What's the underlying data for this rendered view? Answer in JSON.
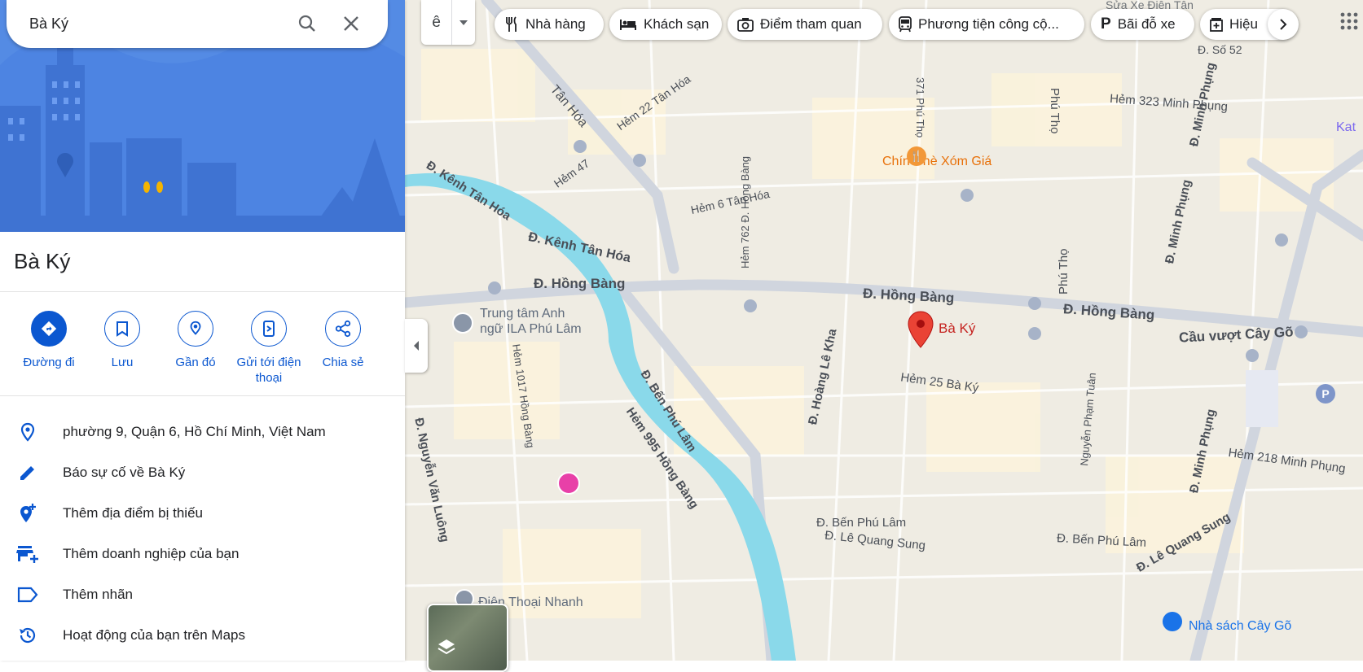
{
  "search": {
    "value": "Bà Ký"
  },
  "place": {
    "title": "Bà Ký"
  },
  "actions": [
    {
      "label": "Đường đi"
    },
    {
      "label": "Lưu"
    },
    {
      "label": "Gần đó"
    },
    {
      "label": "Gửi tới điện thoại"
    },
    {
      "label": "Chia sẻ"
    }
  ],
  "info_rows": [
    {
      "icon": "location-pin-icon",
      "text": "phường 9, Quận 6, Hồ Chí Minh, Việt Nam"
    },
    {
      "icon": "edit-pencil-icon",
      "text": "Báo sự cố về Bà Ký"
    },
    {
      "icon": "add-place-icon",
      "text": "Thêm địa điểm bị thiếu"
    },
    {
      "icon": "add-business-icon",
      "text": "Thêm doanh nghiệp của bạn"
    },
    {
      "icon": "label-icon",
      "text": "Thêm nhãn"
    },
    {
      "icon": "history-icon",
      "text": "Hoạt động của bạn trên Maps"
    }
  ],
  "language_button": {
    "label": "ê"
  },
  "chips": [
    {
      "icon": "restaurant-icon",
      "label": "Nhà hàng"
    },
    {
      "icon": "hotel-icon",
      "label": "Khách sạn"
    },
    {
      "icon": "camera-icon",
      "label": "Điểm tham quan"
    },
    {
      "icon": "transit-icon",
      "label": "Phương tiện công cộ..."
    },
    {
      "icon": "parking-icon",
      "label": "Bãi đỗ xe"
    },
    {
      "icon": "pharmacy-icon",
      "label": "Hiệu"
    }
  ],
  "map_labels": {
    "marker": "Bà Ký",
    "restaurant": "Chín Chè Xóm Giá",
    "school_line1": "Trung tâm Anh",
    "school_line2": "ngữ ILA Phú Lâm",
    "phone_shop": "Điện Thoại Nhanh",
    "bookstore": "Nhà sách Cây Gõ",
    "top_right_shop": "Sửa Xe Điện Tân",
    "kat": "Kat",
    "parking_symbol": "P",
    "roads": [
      "Đ. Hồng Bàng",
      "Đ. Hồng Bàng",
      "Đ. Hồng Bàng",
      "Cầu vượt Cây Gõ",
      "Đ. Kênh Tân Hóa",
      "Đ. Kênh Tân Hóa",
      "Tân Hóa",
      "Hẻm 22 Tân Hóa",
      "Hẻm 6 Tân Hóa",
      "Hẻm 47",
      "Hẻm 762 Đ. Hồng Bàng",
      "371 Phú Thọ",
      "Phú Thọ",
      "Phú Thọ",
      "Hẻm 323 Minh Phụng",
      "Đ. Minh Phụng",
      "Đ. Minh Phụng",
      "Đ. Số 52",
      "Đ. Bến Phú Lâm",
      "Hẻm 995 Hồng Bàng",
      "Hẻm 1017 Hồng Bàng",
      "Đ. Nguyễn Văn Luông",
      "Đ. Hoàng Lê Kha",
      "Hẻm 25 Bà Ký",
      "Nguyễn Phạm Tuân",
      "Đ. Minh Phụng",
      "Hẻm 218 Minh Phụng",
      "Đ. Bến Phú Lâm",
      "Đ. Lê Quang Sung",
      "Đ. Bến Phú Lâm",
      "Đ. Lê Quang Sung"
    ]
  }
}
